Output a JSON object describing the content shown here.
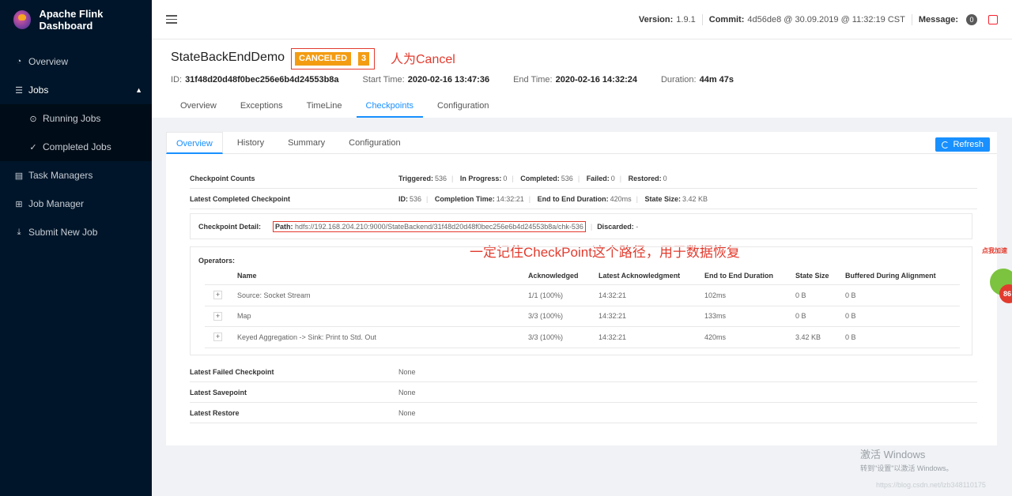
{
  "app": {
    "title": "Apache Flink Dashboard"
  },
  "sidebar": {
    "items": [
      {
        "label": "Overview",
        "icon": "dashboard-icon"
      },
      {
        "label": "Jobs",
        "icon": "list-icon"
      },
      {
        "label": "Running Jobs",
        "icon": "play-circle-icon"
      },
      {
        "label": "Completed Jobs",
        "icon": "check-circle-icon"
      },
      {
        "label": "Task Managers",
        "icon": "server-icon"
      },
      {
        "label": "Job Manager",
        "icon": "cluster-icon"
      },
      {
        "label": "Submit New Job",
        "icon": "upload-icon"
      }
    ]
  },
  "header": {
    "version_label": "Version:",
    "version": "1.9.1",
    "commit_label": "Commit:",
    "commit": "4d56de8 @ 30.09.2019 @ 11:32:19 CST",
    "message_label": "Message:",
    "message_count": "0"
  },
  "job": {
    "name": "StateBackEndDemo",
    "status": "CANCELED",
    "task_count": "3",
    "annotation": "人为Cancel",
    "id_label": "ID:",
    "id": "31f48d20d48f0bec256e6b4d24553b8a",
    "start_label": "Start Time:",
    "start": "2020-02-16 13:47:36",
    "end_label": "End Time:",
    "end": "2020-02-16 14:32:24",
    "duration_label": "Duration:",
    "duration": "44m 47s",
    "tabs": [
      "Overview",
      "Exceptions",
      "TimeLine",
      "Checkpoints",
      "Configuration"
    ]
  },
  "checkpoints": {
    "subtabs": [
      "Overview",
      "History",
      "Summary",
      "Configuration"
    ],
    "refresh_label": "Refresh",
    "counts": {
      "label": "Checkpoint Counts",
      "triggered_label": "Triggered:",
      "triggered": "536",
      "in_progress_label": "In Progress:",
      "in_progress": "0",
      "completed_label": "Completed:",
      "completed": "536",
      "failed_label": "Failed:",
      "failed": "0",
      "restored_label": "Restored:",
      "restored": "0"
    },
    "latest_completed": {
      "label": "Latest Completed Checkpoint",
      "id_label": "ID:",
      "id": "536",
      "completion_time_label": "Completion Time:",
      "completion_time": "14:32:21",
      "e2e_label": "End to End Duration:",
      "e2e": "420ms",
      "state_size_label": "State Size:",
      "state_size": "3.42 KB"
    },
    "detail": {
      "label": "Checkpoint Detail:",
      "path_label": "Path:",
      "path": "hdfs://192.168.204.210:9000/StateBackend/31f48d20d48f0bec256e6b4d24553b8a/chk-536",
      "discarded_label": "Discarded:",
      "discarded": "-"
    },
    "path_annotation": "一定记住CheckPoint这个路径，用于数据恢复",
    "operators": {
      "title": "Operators:",
      "headers": [
        "Name",
        "Acknowledged",
        "Latest Acknowledgment",
        "End to End Duration",
        "State Size",
        "Buffered During Alignment"
      ],
      "rows": [
        {
          "name": "Source: Socket Stream",
          "ack": "1/1 (100%)",
          "latest": "14:32:21",
          "e2e": "102ms",
          "size": "0 B",
          "buffered": "0 B"
        },
        {
          "name": "Map",
          "ack": "3/3 (100%)",
          "latest": "14:32:21",
          "e2e": "133ms",
          "size": "0 B",
          "buffered": "0 B"
        },
        {
          "name": "Keyed Aggregation -> Sink: Print to Std. Out",
          "ack": "3/3 (100%)",
          "latest": "14:32:21",
          "e2e": "420ms",
          "size": "3.42 KB",
          "buffered": "0 B"
        }
      ]
    },
    "latest_failed": {
      "label": "Latest Failed Checkpoint",
      "value": "None"
    },
    "latest_savepoint": {
      "label": "Latest Savepoint",
      "value": "None"
    },
    "latest_restore": {
      "label": "Latest Restore",
      "value": "None"
    }
  },
  "overlay": {
    "windows_title": "激活 Windows",
    "windows_sub": "转到\"设置\"以激活 Windows。",
    "csdn": "https://blog.csdn.net/lzb348110175",
    "ad_text": "点我加速",
    "ad_number": "86"
  }
}
